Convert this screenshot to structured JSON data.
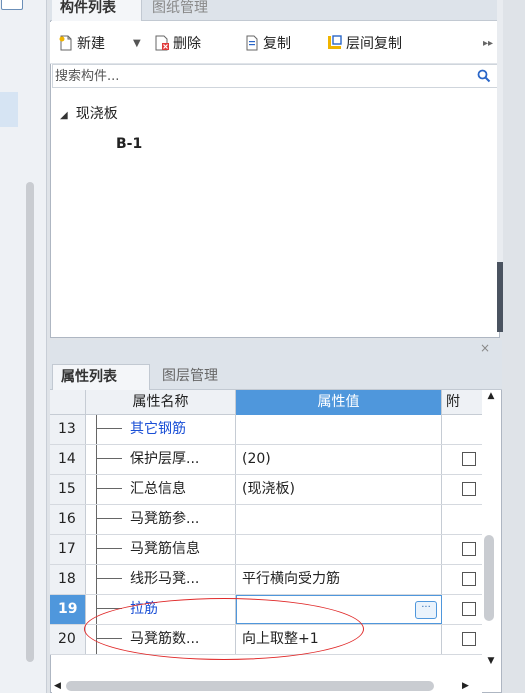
{
  "component_panel": {
    "tabs": [
      "构件列表",
      "图纸管理"
    ],
    "toolbar": {
      "new_label": "新建",
      "delete_label": "删除",
      "copy_label": "复制",
      "floor_copy_label": "层间复制",
      "more_icon": "double-chevron-right"
    },
    "search": {
      "placeholder": "搜索构件..."
    },
    "tree": {
      "root_label": "现浇板",
      "child_label": "B-1"
    }
  },
  "property_panel": {
    "tabs": [
      "属性列表",
      "图层管理"
    ],
    "close_glyph": "×",
    "columns": {
      "num": "",
      "name": "属性名称",
      "value": "属性值",
      "attach": "附"
    },
    "rows": [
      {
        "num": "13",
        "name": "其它钢筋",
        "value": "",
        "blue": true,
        "checkbox": false
      },
      {
        "num": "14",
        "name": "保护层厚...",
        "value": "(20)",
        "blue": false,
        "checkbox": true
      },
      {
        "num": "15",
        "name": "汇总信息",
        "value": "(现浇板)",
        "blue": false,
        "checkbox": true
      },
      {
        "num": "16",
        "name": "马凳筋参...",
        "value": "",
        "blue": false,
        "checkbox": false
      },
      {
        "num": "17",
        "name": "马凳筋信息",
        "value": "",
        "blue": false,
        "checkbox": true
      },
      {
        "num": "18",
        "name": "线形马凳...",
        "value": "平行横向受力筋",
        "blue": false,
        "checkbox": true
      },
      {
        "num": "19",
        "name": "拉筋",
        "value": "",
        "blue": true,
        "checkbox": true,
        "selected": true
      },
      {
        "num": "20",
        "name": "马凳筋数...",
        "value": "向上取整+1",
        "blue": false,
        "checkbox": true
      }
    ],
    "ellipsis_glyph": "···"
  },
  "colors": {
    "accent": "#4f97dc",
    "link_blue": "#1a4fd6",
    "annotation_red": "#e02a2a"
  }
}
